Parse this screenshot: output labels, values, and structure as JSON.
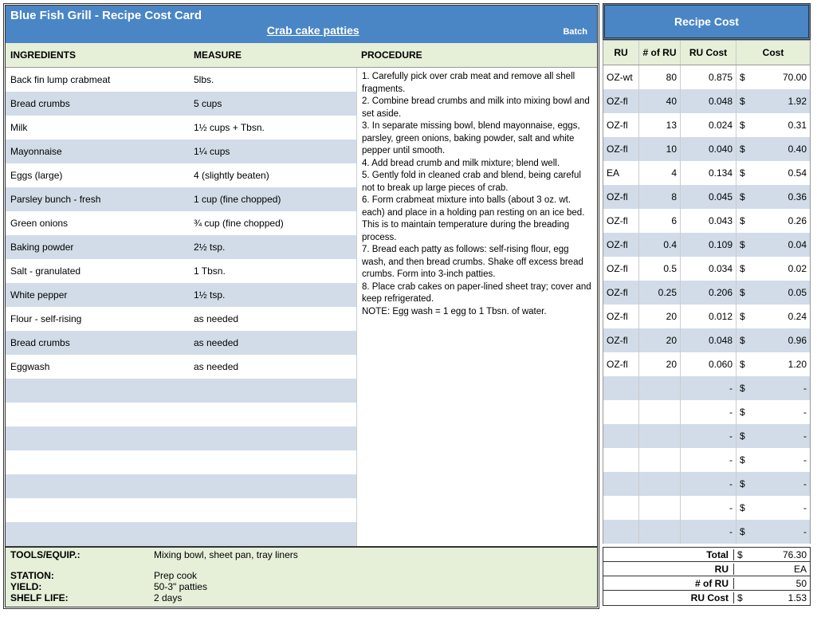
{
  "header": {
    "title": "Blue Fish Grill - Recipe Cost Card",
    "recipe": "Crab cake patties",
    "batch": "Batch",
    "rc_title": "Recipe Cost"
  },
  "col": {
    "ingredients": "INGREDIENTS",
    "measure": "MEASURE",
    "procedure": "PROCEDURE",
    "ru": "RU",
    "num_ru": "# of RU",
    "ru_cost": "RU Cost",
    "cost": "Cost"
  },
  "ingredients": [
    {
      "name": "Back fin lump crabmeat",
      "measure": "5lbs.",
      "ru": "OZ-wt",
      "num": "80",
      "rucost": "0.875",
      "cost": "70.00"
    },
    {
      "name": "Bread crumbs",
      "measure": "5 cups",
      "ru": "OZ-fl",
      "num": "40",
      "rucost": "0.048",
      "cost": "1.92"
    },
    {
      "name": "Milk",
      "measure": "1½ cups + Tbsn.",
      "ru": "OZ-fl",
      "num": "13",
      "rucost": "0.024",
      "cost": "0.31"
    },
    {
      "name": "Mayonnaise",
      "measure": "1¼ cups",
      "ru": "OZ-fl",
      "num": "10",
      "rucost": "0.040",
      "cost": "0.40"
    },
    {
      "name": "Eggs (large)",
      "measure": "4 (slightly beaten)",
      "ru": "EA",
      "num": "4",
      "rucost": "0.134",
      "cost": "0.54"
    },
    {
      "name": "Parsley bunch - fresh",
      "measure": "1 cup (fine chopped)",
      "ru": "OZ-fl",
      "num": "8",
      "rucost": "0.045",
      "cost": "0.36"
    },
    {
      "name": "Green onions",
      "measure": "¾ cup (fine chopped)",
      "ru": "OZ-fl",
      "num": "6",
      "rucost": "0.043",
      "cost": "0.26"
    },
    {
      "name": "Baking powder",
      "measure": "2½ tsp.",
      "ru": "OZ-fl",
      "num": "0.4",
      "rucost": "0.109",
      "cost": "0.04"
    },
    {
      "name": "Salt - granulated",
      "measure": "1 Tbsn.",
      "ru": "OZ-fl",
      "num": "0.5",
      "rucost": "0.034",
      "cost": "0.02"
    },
    {
      "name": "White pepper",
      "measure": "1½ tsp.",
      "ru": "OZ-fl",
      "num": "0.25",
      "rucost": "0.206",
      "cost": "0.05"
    },
    {
      "name": "Flour - self-rising",
      "measure": "as needed",
      "ru": "OZ-fl",
      "num": "20",
      "rucost": "0.012",
      "cost": "0.24"
    },
    {
      "name": "Bread crumbs",
      "measure": "as needed",
      "ru": "OZ-fl",
      "num": "20",
      "rucost": "0.048",
      "cost": "0.96"
    },
    {
      "name": "Eggwash",
      "measure": "as needed",
      "ru": "OZ-fl",
      "num": "20",
      "rucost": "0.060",
      "cost": "1.20"
    },
    {
      "name": "",
      "measure": "",
      "ru": "",
      "num": "",
      "rucost": "-",
      "cost": "-"
    },
    {
      "name": "",
      "measure": "",
      "ru": "",
      "num": "",
      "rucost": "-",
      "cost": "-"
    },
    {
      "name": "",
      "measure": "",
      "ru": "",
      "num": "",
      "rucost": "-",
      "cost": "-"
    },
    {
      "name": "",
      "measure": "",
      "ru": "",
      "num": "",
      "rucost": "-",
      "cost": "-"
    },
    {
      "name": "",
      "measure": "",
      "ru": "",
      "num": "",
      "rucost": "-",
      "cost": "-"
    },
    {
      "name": "",
      "measure": "",
      "ru": "",
      "num": "",
      "rucost": "-",
      "cost": "-"
    },
    {
      "name": "",
      "measure": "",
      "ru": "",
      "num": "",
      "rucost": "-",
      "cost": "-"
    }
  ],
  "procedure": [
    "1. Carefully pick over crab meat and remove all shell fragments.",
    "2. Combine bread crumbs and milk into mixing bowl and set aside.",
    "3. In separate missing bowl, blend mayonnaise, eggs, parsley, green onions, baking powder, salt and white pepper until smooth.",
    "4. Add bread crumb and milk mixture; blend well.",
    "5. Gently fold in cleaned crab and blend, being careful not to break up large pieces of crab.",
    "6. Form crabmeat mixture into balls (about 3 oz. wt. each) and place in a holding pan resting on an ice bed. This is to maintain temperature during the breading process.",
    "7. Bread each patty as follows: self-rising flour, egg wash, and then bread crumbs. Shake off excess bread crumbs. Form into 3-inch patties.",
    "8. Place crab cakes on paper-lined sheet tray; cover and keep refrigerated.",
    "NOTE: Egg wash = 1 egg to 1 Tbsn. of water."
  ],
  "footer": {
    "tools_label": "TOOLS/EQUIP.:",
    "tools": "Mixing bowl, sheet pan, tray liners",
    "station_label": "STATION:",
    "station": "Prep cook",
    "yield_label": "YIELD:",
    "yield": "50-3\" patties",
    "shelf_label": "SHELF LIFE:",
    "shelf": "2 days"
  },
  "summary": {
    "total_label": "Total",
    "total": "76.30",
    "ru_label": "RU",
    "ru": "EA",
    "num_ru_label": "# of RU",
    "num_ru": "50",
    "ru_cost_label": "RU Cost",
    "ru_cost": "1.53"
  }
}
